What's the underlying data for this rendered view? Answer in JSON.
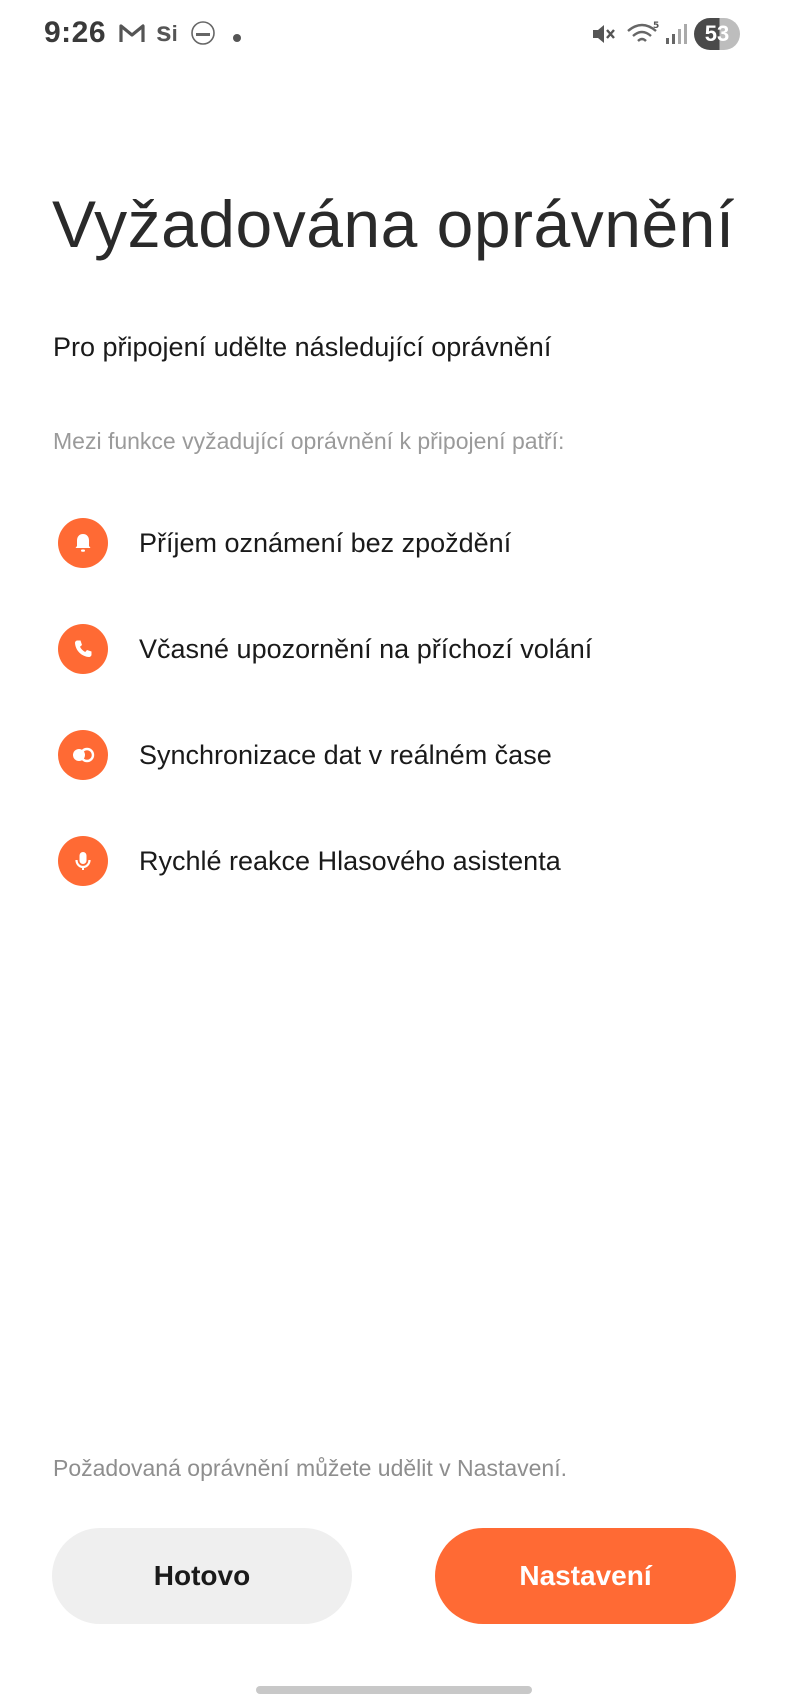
{
  "status_bar": {
    "time": "9:26",
    "left_icons": [
      "gmail-icon",
      "si-app-icon",
      "albert-app-icon",
      "notification-dot-icon"
    ],
    "right_icons": [
      "mute-icon",
      "wifi-icon",
      "signal-icon"
    ],
    "battery_level": "53"
  },
  "page": {
    "title": "Vyžadována oprávnění",
    "subtitle": "Pro připojení udělte následující oprávnění",
    "section_label": "Mezi funkce vyžadující oprávnění k připojení patří:",
    "features": [
      {
        "icon": "bell-icon",
        "label": "Příjem oznámení bez zpoždění"
      },
      {
        "icon": "phone-icon",
        "label": "Včasné upozornění na příchozí volání"
      },
      {
        "icon": "sync-icon",
        "label": "Synchronizace dat v reálném čase"
      },
      {
        "icon": "microphone-icon",
        "label": "Rychlé reakce Hlasového asistenta"
      }
    ],
    "footer_note": "Požadovaná oprávnění můžete udělit v Nastavení."
  },
  "actions": {
    "done_label": "Hotovo",
    "settings_label": "Nastavení"
  },
  "colors": {
    "accent": "#ff6a34",
    "secondary_button": "#efefef",
    "muted_text": "#9a9a9a"
  }
}
